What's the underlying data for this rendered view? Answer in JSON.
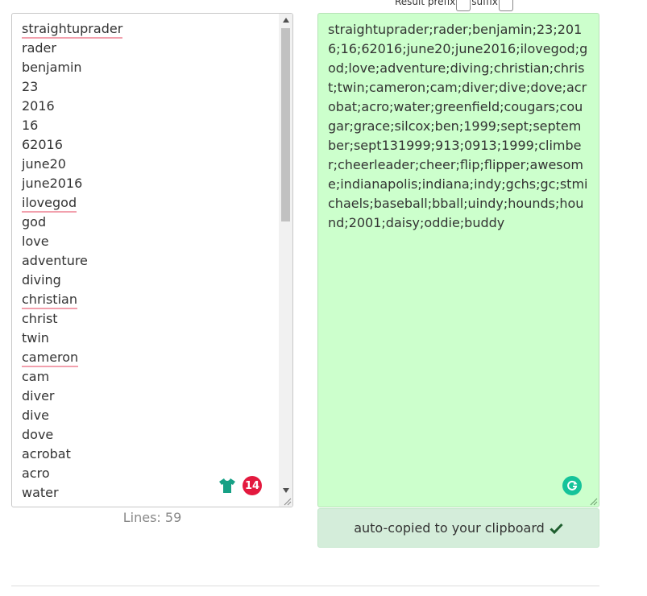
{
  "prefix_bar": {
    "prefix_label": "Result prefix",
    "prefix_value": "",
    "suffix_label": "suffix",
    "suffix_value": ""
  },
  "input": {
    "lines": [
      {
        "text": "straightuprader",
        "spell": true
      },
      {
        "text": "rader",
        "spell": false
      },
      {
        "text": "benjamin",
        "spell": false
      },
      {
        "text": "23",
        "spell": false
      },
      {
        "text": "2016",
        "spell": false
      },
      {
        "text": "16",
        "spell": false
      },
      {
        "text": "62016",
        "spell": false
      },
      {
        "text": "june20",
        "spell": false
      },
      {
        "text": "june2016",
        "spell": false
      },
      {
        "text": "ilovegod",
        "spell": true
      },
      {
        "text": "god",
        "spell": false
      },
      {
        "text": "love",
        "spell": false
      },
      {
        "text": "adventure",
        "spell": false
      },
      {
        "text": "diving",
        "spell": false
      },
      {
        "text": "christian",
        "spell": true
      },
      {
        "text": "christ",
        "spell": false
      },
      {
        "text": "twin",
        "spell": false
      },
      {
        "text": "cameron",
        "spell": true
      },
      {
        "text": "cam",
        "spell": false
      },
      {
        "text": "diver",
        "spell": false
      },
      {
        "text": "dive",
        "spell": false
      },
      {
        "text": "dove",
        "spell": false
      },
      {
        "text": "acrobat",
        "spell": false
      },
      {
        "text": "acro",
        "spell": false
      },
      {
        "text": "water",
        "spell": false
      },
      {
        "text": "greenfield",
        "spell": false
      }
    ],
    "grammarly_count": "14",
    "lines_label": "Lines: 59"
  },
  "output": {
    "text": "straightuprader;rader;benjamin;23;2016;16;62016;june20;june2016;ilovegod;god;love;adventure;diving;christian;christ;twin;cameron;cam;diver;dive;dove;acrobat;acro;water;greenfield;cougars;cougar;grace;silcox;ben;1999;sept;september;sept131999;913;0913;1999;climber;cheerleader;cheer;flip;flipper;awesome;indianapolis;indiana;indy;gchs;gc;stmichaels;baseball;bball;uindy;hounds;hound;2001;daisy;oddie;buddy",
    "copied_label": "auto-copied to your clipboard"
  },
  "colors": {
    "output_bg": "#ccffcc",
    "copied_bg": "#d4edda",
    "badge_red": "#e3193e",
    "grammarly_green": "#15c39a",
    "spell_underline": "#f2a0ad"
  }
}
